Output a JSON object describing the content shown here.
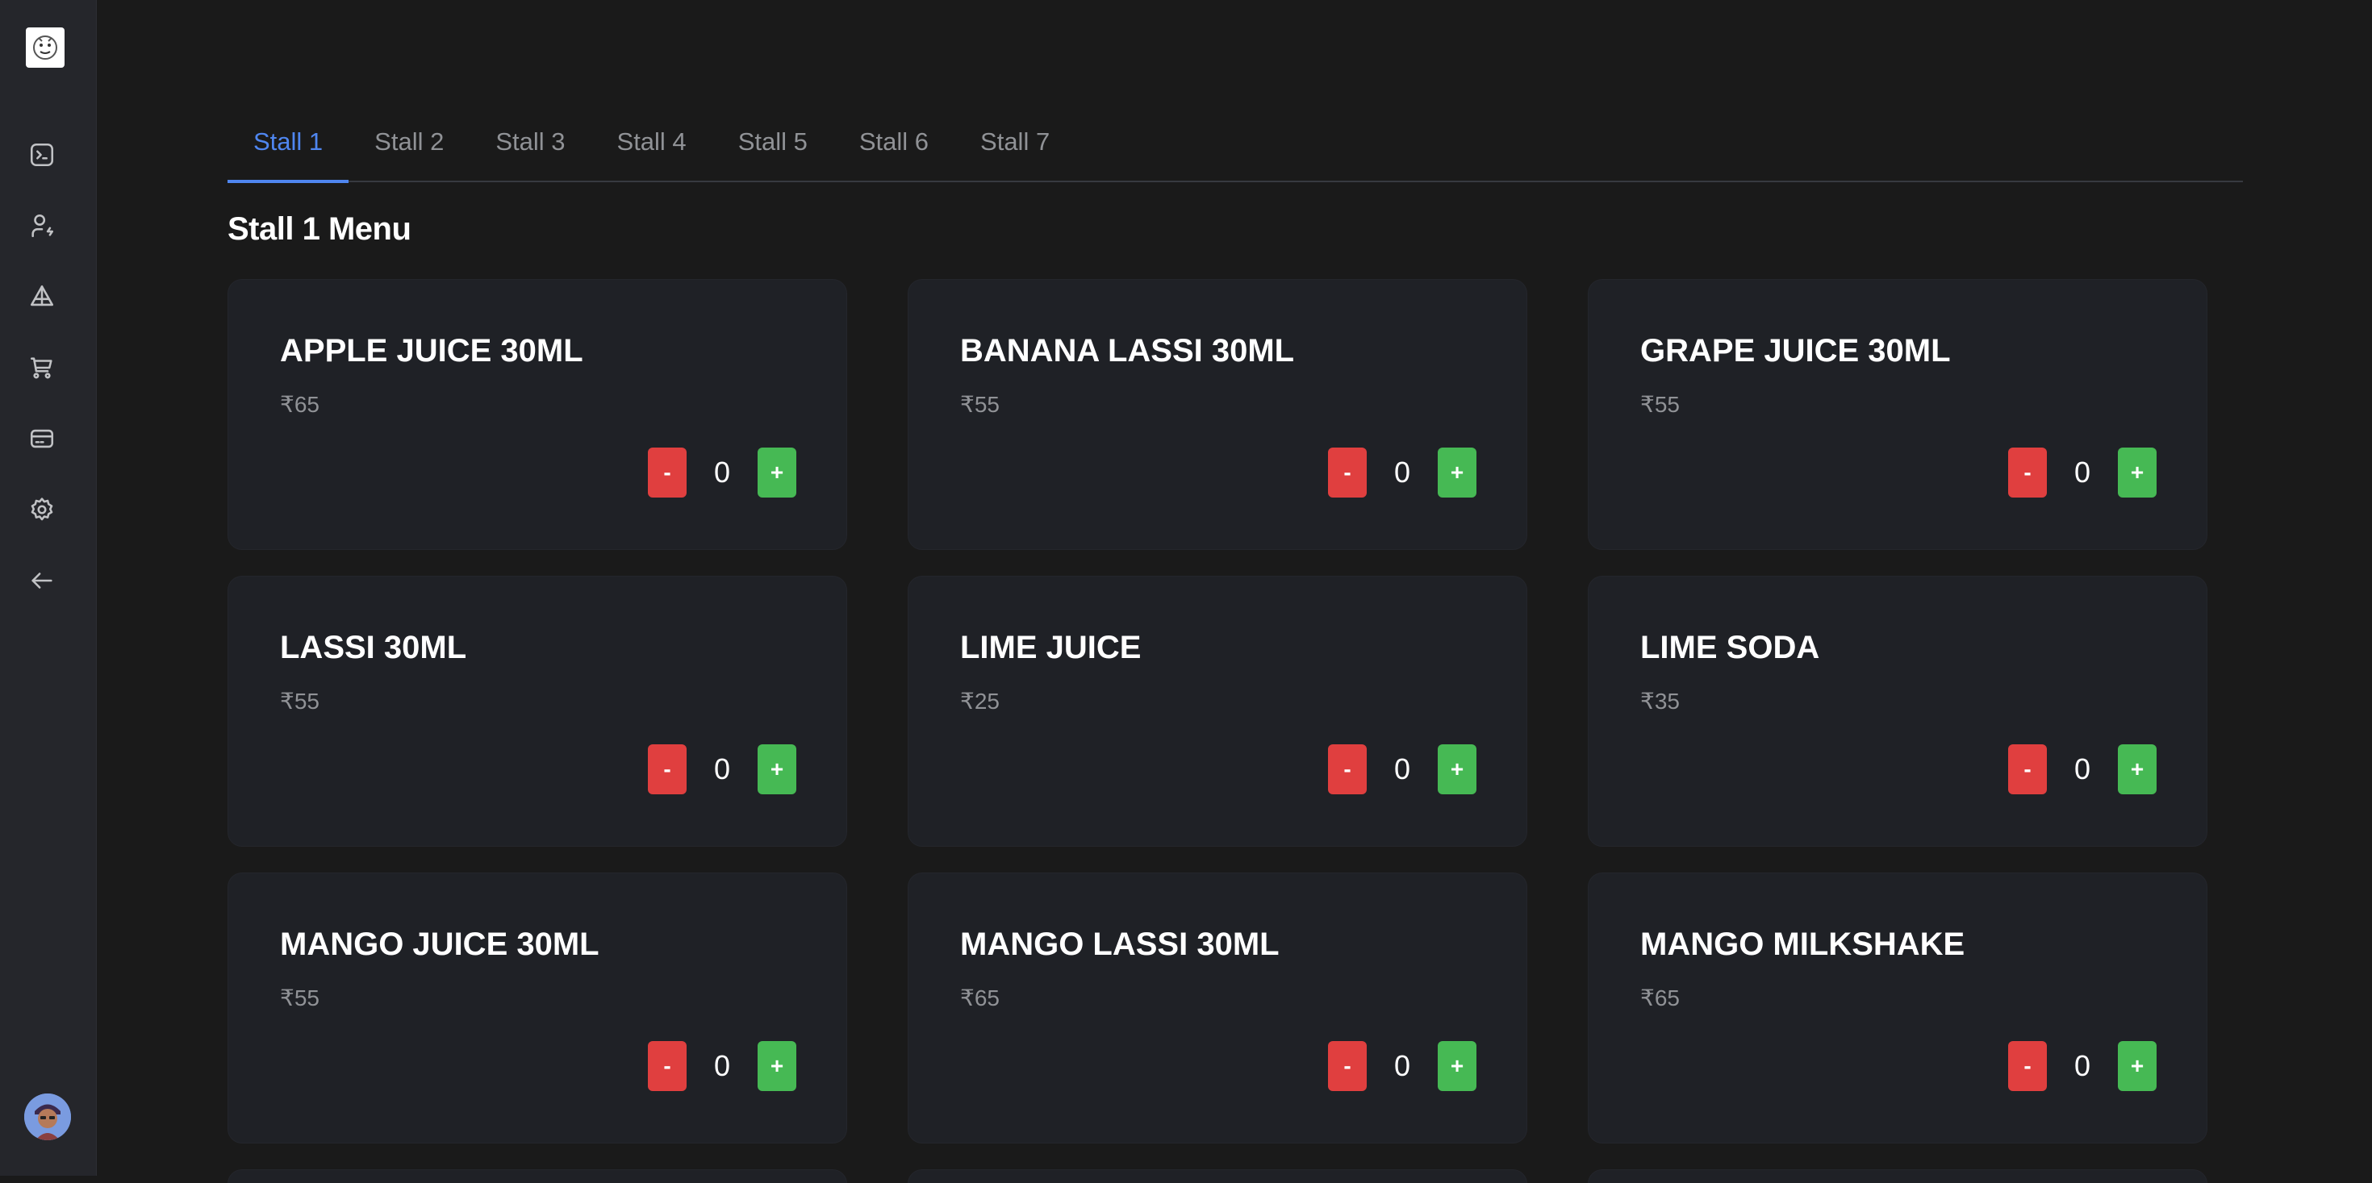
{
  "tabs": [
    "Stall 1",
    "Stall 2",
    "Stall 3",
    "Stall 4",
    "Stall 5",
    "Stall 6",
    "Stall 7"
  ],
  "active_tab": "Stall 1",
  "menu_title": "Stall 1 Menu",
  "sidebar": {
    "icons": [
      "terminal-icon",
      "user-bolt-icon",
      "pyramid-icon",
      "cart-icon",
      "credit-card-icon",
      "gear-icon",
      "arrow-left-icon"
    ]
  },
  "colors": {
    "accent": "#4f86f0",
    "minus": "#e03f3f",
    "plus": "#46b954",
    "background": "#1a1a1a",
    "card": "#1f2126"
  },
  "items": [
    {
      "name": "APPLE JUICE 30ML",
      "price": "₹65",
      "qty": "0"
    },
    {
      "name": "BANANA LASSI 30ML",
      "price": "₹55",
      "qty": "0"
    },
    {
      "name": "GRAPE JUICE 30ML",
      "price": "₹55",
      "qty": "0"
    },
    {
      "name": "LASSI 30ML",
      "price": "₹55",
      "qty": "0"
    },
    {
      "name": "LIME JUICE",
      "price": "₹25",
      "qty": "0"
    },
    {
      "name": "LIME SODA",
      "price": "₹35",
      "qty": "0"
    },
    {
      "name": "MANGO JUICE 30ML",
      "price": "₹55",
      "qty": "0"
    },
    {
      "name": "MANGO LASSI 30ML",
      "price": "₹65",
      "qty": "0"
    },
    {
      "name": "MANGO MILKSHAKE",
      "price": "₹65",
      "qty": "0"
    }
  ],
  "buttons": {
    "minus": "-",
    "plus": "+"
  }
}
